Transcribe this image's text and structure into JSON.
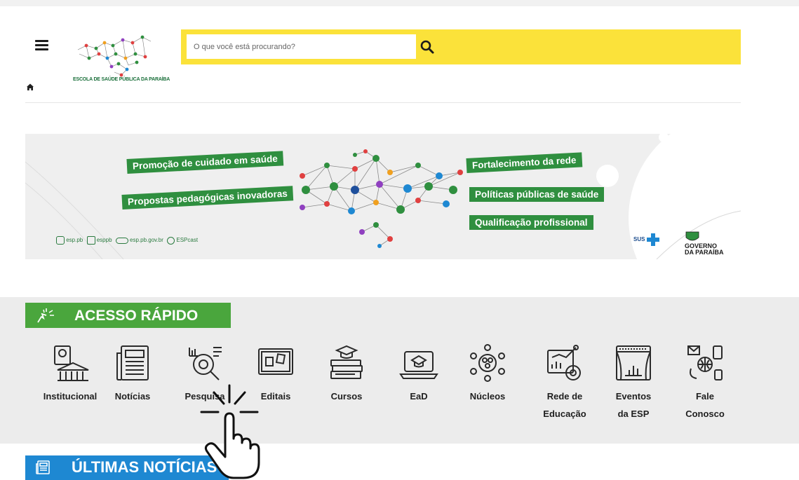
{
  "search": {
    "placeholder": "O que você está procurando?"
  },
  "logo": {
    "text": "ESCOLA DE SAÚDE PÚBLICA DA PARAÍBA"
  },
  "banner": {
    "tags_left": [
      "Promoção de cuidado em saúde",
      "Propostas pedagógicas inovadoras"
    ],
    "tags_right": [
      "Fortalecimento da rede",
      "Políticas públicas de saúde",
      "Qualificação profissional"
    ],
    "social": {
      "instagram": "esp.pb",
      "facebook": "esppb",
      "site": "esp.pb.gov.br",
      "podcast": "ESPcast"
    },
    "sus": "SUS",
    "gov_line1": "GOVERNO",
    "gov_line2": "DA PARAÍBA"
  },
  "quick_access": {
    "title": "ACESSO RÁPIDO",
    "items": [
      {
        "label": "Institucional",
        "icon": "building-icon"
      },
      {
        "label": "Notícias",
        "icon": "newspaper-icon"
      },
      {
        "label": "Pesquisa",
        "icon": "research-icon"
      },
      {
        "label": "Editais",
        "icon": "notice-board-icon"
      },
      {
        "label": "Cursos",
        "icon": "books-icon"
      },
      {
        "label": "EaD",
        "icon": "laptop-graduation-icon"
      },
      {
        "label": "Núcleos",
        "icon": "network-people-icon"
      },
      {
        "label": "Rede de Educação",
        "icon": "chart-gear-icon"
      },
      {
        "label": "Eventos da ESP",
        "icon": "stage-icon"
      },
      {
        "label": "Fale Conosco",
        "icon": "contact-icon"
      }
    ]
  },
  "news": {
    "title": "ÚLTIMAS NOTÍCIAS"
  },
  "colors": {
    "yellow": "#fbe23a",
    "green": "#4aa63d",
    "blue": "#1e88d2",
    "banner_green": "#2f8f3f"
  }
}
